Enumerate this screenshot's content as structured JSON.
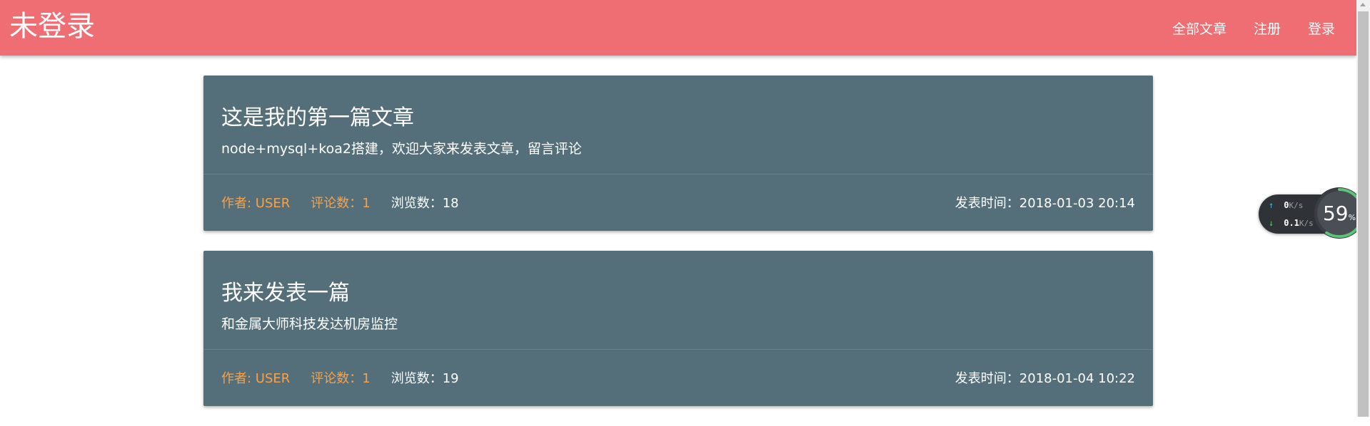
{
  "header": {
    "brand": "未登录",
    "nav": [
      {
        "label": "全部文章"
      },
      {
        "label": "注册"
      },
      {
        "label": "登录"
      }
    ]
  },
  "articles": [
    {
      "title": "这是我的第一篇文章",
      "description": "node+mysql+koa2搭建，欢迎大家来发表文章，留言评论",
      "author": "作者: USER",
      "comments": "评论数：1",
      "views": "浏览数：18",
      "time": "发表时间：2018-01-03 20:14"
    },
    {
      "title": "我来发表一篇",
      "description": "和金属大师科技发达机房监控",
      "author": "作者: USER",
      "comments": "评论数：1",
      "views": "浏览数：19",
      "time": "发表时间：2018-01-04 10:22"
    }
  ],
  "speed_widget": {
    "up_value": "0",
    "up_unit": "K/s",
    "down_value": "0.1",
    "down_unit": "K/s",
    "cpu_percent": "59",
    "cpu_unit": "%",
    "cpu_level": 0.59
  },
  "colors": {
    "navbar": "#ef6e73",
    "card": "#546f7a",
    "meta_accent": "#f7a24a"
  }
}
